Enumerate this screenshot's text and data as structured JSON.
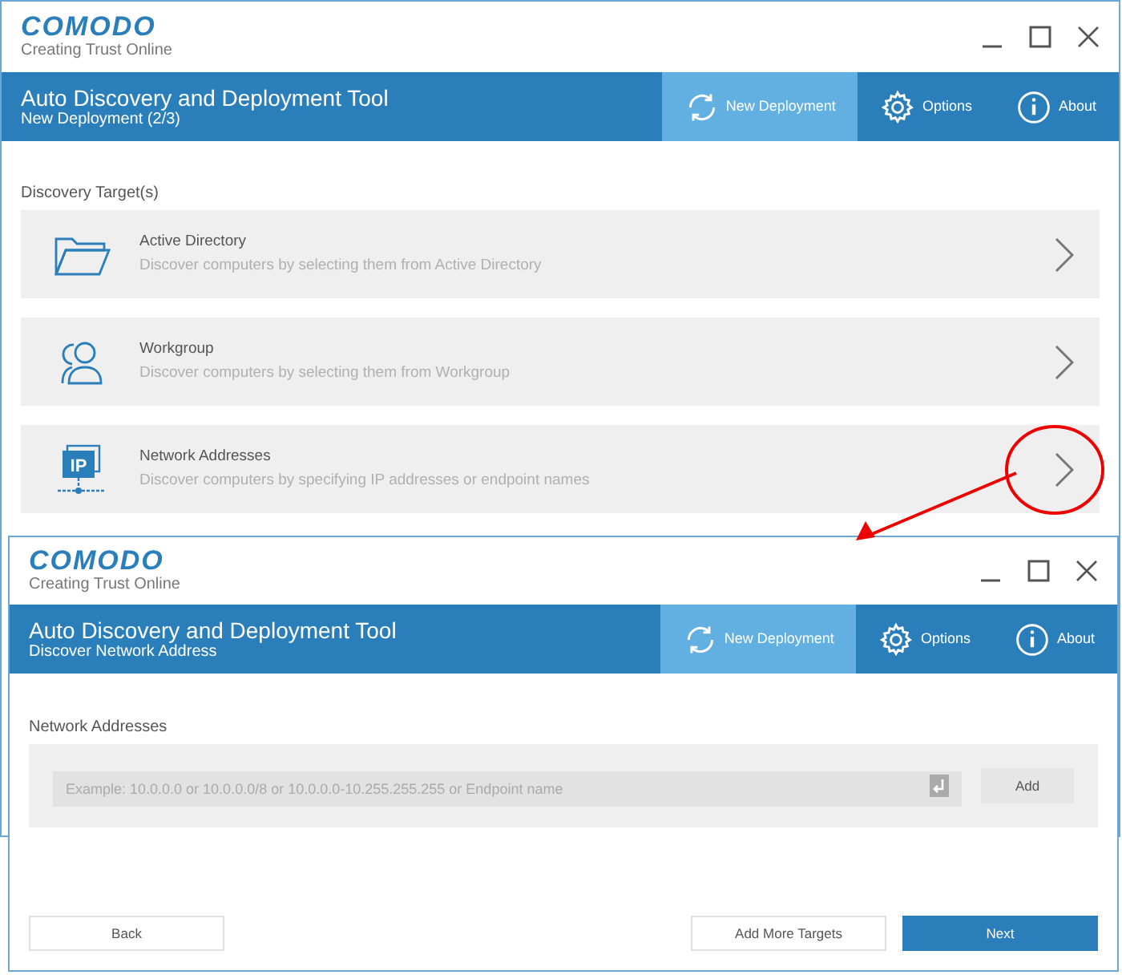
{
  "windows": [
    {
      "logo": {
        "name": "COMODO",
        "tagline": "Creating Trust Online"
      },
      "title": "Auto Discovery and Deployment Tool",
      "subtitle": "New Deployment (2/3)",
      "tabs": [
        {
          "label": "New Deployment",
          "kind": "refresh",
          "selected": true
        },
        {
          "label": "Options",
          "kind": "gear",
          "selected": false
        },
        {
          "label": "About",
          "kind": "info",
          "selected": false
        }
      ],
      "section": "Discovery Target(s)",
      "targets": [
        {
          "kind": "folder",
          "title": "Active Directory",
          "description": "Discover computers by selecting them from Active Directory"
        },
        {
          "kind": "users",
          "title": "Workgroup",
          "description": "Discover computers by selecting them from Workgroup"
        },
        {
          "kind": "ip",
          "badge": "IP",
          "title": "Network Addresses",
          "description": "Discover computers by specifying IP addresses or endpoint names"
        }
      ]
    },
    {
      "logo": {
        "name": "COMODO",
        "tagline": "Creating Trust Online"
      },
      "title": "Auto Discovery and Deployment Tool",
      "subtitle": "Discover Network Address",
      "tabs": [
        {
          "label": "New Deployment",
          "kind": "refresh",
          "selected": true
        },
        {
          "label": "Options",
          "kind": "gear",
          "selected": false
        },
        {
          "label": "About",
          "kind": "info",
          "selected": false
        }
      ],
      "section": "Network Addresses",
      "address_field": {
        "placeholder": "Example: 10.0.0.0 or 10.0.0.0/8 or 10.0.0.0-10.255.255.255 or Endpoint name",
        "button": "Add"
      },
      "buttons": [
        {
          "label": "Back",
          "kind": "secondary"
        },
        {
          "label": "Add More Targets",
          "kind": "secondary"
        },
        {
          "label": "Next",
          "kind": "primary"
        }
      ]
    }
  ]
}
